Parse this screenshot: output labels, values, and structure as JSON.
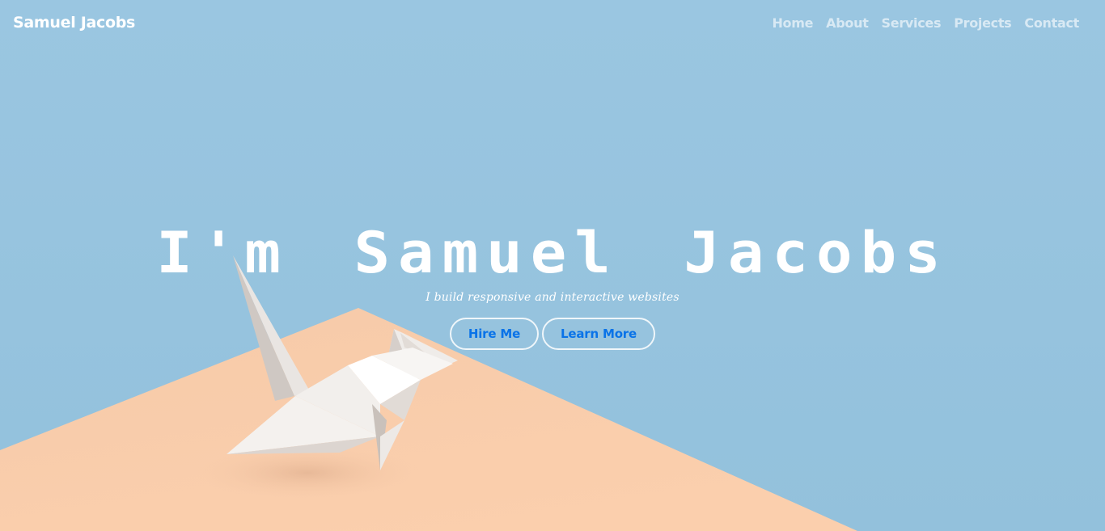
{
  "navbar": {
    "brand": "Samuel Jacobs",
    "links": [
      {
        "label": "Home"
      },
      {
        "label": "About"
      },
      {
        "label": "Services"
      },
      {
        "label": "Projects"
      },
      {
        "label": "Contact"
      }
    ]
  },
  "hero": {
    "title": "I'm Samuel Jacobs",
    "subtitle": "I build responsive and interactive websites",
    "buttons": {
      "hire_label": "Hire Me",
      "learn_label": "Learn More"
    }
  },
  "colors": {
    "sky": "#9ac6e1",
    "ground": "#f7cbab",
    "accent": "#0a73e8",
    "text": "#ffffff"
  },
  "icons": {
    "hero_illustration": "origami-crane"
  }
}
